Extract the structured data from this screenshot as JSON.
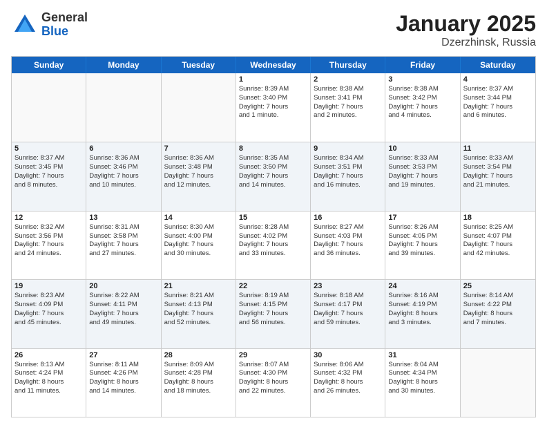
{
  "header": {
    "logo": {
      "general": "General",
      "blue": "Blue"
    },
    "title": "January 2025",
    "location": "Dzerzhinsk, Russia"
  },
  "weekdays": [
    "Sunday",
    "Monday",
    "Tuesday",
    "Wednesday",
    "Thursday",
    "Friday",
    "Saturday"
  ],
  "weeks": [
    [
      {
        "day": "",
        "empty": true,
        "info": ""
      },
      {
        "day": "",
        "empty": true,
        "info": ""
      },
      {
        "day": "",
        "empty": true,
        "info": ""
      },
      {
        "day": "1",
        "empty": false,
        "info": "Sunrise: 8:39 AM\nSunset: 3:40 PM\nDaylight: 7 hours\nand 1 minute."
      },
      {
        "day": "2",
        "empty": false,
        "info": "Sunrise: 8:38 AM\nSunset: 3:41 PM\nDaylight: 7 hours\nand 2 minutes."
      },
      {
        "day": "3",
        "empty": false,
        "info": "Sunrise: 8:38 AM\nSunset: 3:42 PM\nDaylight: 7 hours\nand 4 minutes."
      },
      {
        "day": "4",
        "empty": false,
        "info": "Sunrise: 8:37 AM\nSunset: 3:44 PM\nDaylight: 7 hours\nand 6 minutes."
      }
    ],
    [
      {
        "day": "5",
        "empty": false,
        "info": "Sunrise: 8:37 AM\nSunset: 3:45 PM\nDaylight: 7 hours\nand 8 minutes."
      },
      {
        "day": "6",
        "empty": false,
        "info": "Sunrise: 8:36 AM\nSunset: 3:46 PM\nDaylight: 7 hours\nand 10 minutes."
      },
      {
        "day": "7",
        "empty": false,
        "info": "Sunrise: 8:36 AM\nSunset: 3:48 PM\nDaylight: 7 hours\nand 12 minutes."
      },
      {
        "day": "8",
        "empty": false,
        "info": "Sunrise: 8:35 AM\nSunset: 3:50 PM\nDaylight: 7 hours\nand 14 minutes."
      },
      {
        "day": "9",
        "empty": false,
        "info": "Sunrise: 8:34 AM\nSunset: 3:51 PM\nDaylight: 7 hours\nand 16 minutes."
      },
      {
        "day": "10",
        "empty": false,
        "info": "Sunrise: 8:33 AM\nSunset: 3:53 PM\nDaylight: 7 hours\nand 19 minutes."
      },
      {
        "day": "11",
        "empty": false,
        "info": "Sunrise: 8:33 AM\nSunset: 3:54 PM\nDaylight: 7 hours\nand 21 minutes."
      }
    ],
    [
      {
        "day": "12",
        "empty": false,
        "info": "Sunrise: 8:32 AM\nSunset: 3:56 PM\nDaylight: 7 hours\nand 24 minutes."
      },
      {
        "day": "13",
        "empty": false,
        "info": "Sunrise: 8:31 AM\nSunset: 3:58 PM\nDaylight: 7 hours\nand 27 minutes."
      },
      {
        "day": "14",
        "empty": false,
        "info": "Sunrise: 8:30 AM\nSunset: 4:00 PM\nDaylight: 7 hours\nand 30 minutes."
      },
      {
        "day": "15",
        "empty": false,
        "info": "Sunrise: 8:28 AM\nSunset: 4:02 PM\nDaylight: 7 hours\nand 33 minutes."
      },
      {
        "day": "16",
        "empty": false,
        "info": "Sunrise: 8:27 AM\nSunset: 4:03 PM\nDaylight: 7 hours\nand 36 minutes."
      },
      {
        "day": "17",
        "empty": false,
        "info": "Sunrise: 8:26 AM\nSunset: 4:05 PM\nDaylight: 7 hours\nand 39 minutes."
      },
      {
        "day": "18",
        "empty": false,
        "info": "Sunrise: 8:25 AM\nSunset: 4:07 PM\nDaylight: 7 hours\nand 42 minutes."
      }
    ],
    [
      {
        "day": "19",
        "empty": false,
        "info": "Sunrise: 8:23 AM\nSunset: 4:09 PM\nDaylight: 7 hours\nand 45 minutes."
      },
      {
        "day": "20",
        "empty": false,
        "info": "Sunrise: 8:22 AM\nSunset: 4:11 PM\nDaylight: 7 hours\nand 49 minutes."
      },
      {
        "day": "21",
        "empty": false,
        "info": "Sunrise: 8:21 AM\nSunset: 4:13 PM\nDaylight: 7 hours\nand 52 minutes."
      },
      {
        "day": "22",
        "empty": false,
        "info": "Sunrise: 8:19 AM\nSunset: 4:15 PM\nDaylight: 7 hours\nand 56 minutes."
      },
      {
        "day": "23",
        "empty": false,
        "info": "Sunrise: 8:18 AM\nSunset: 4:17 PM\nDaylight: 7 hours\nand 59 minutes."
      },
      {
        "day": "24",
        "empty": false,
        "info": "Sunrise: 8:16 AM\nSunset: 4:19 PM\nDaylight: 8 hours\nand 3 minutes."
      },
      {
        "day": "25",
        "empty": false,
        "info": "Sunrise: 8:14 AM\nSunset: 4:22 PM\nDaylight: 8 hours\nand 7 minutes."
      }
    ],
    [
      {
        "day": "26",
        "empty": false,
        "info": "Sunrise: 8:13 AM\nSunset: 4:24 PM\nDaylight: 8 hours\nand 11 minutes."
      },
      {
        "day": "27",
        "empty": false,
        "info": "Sunrise: 8:11 AM\nSunset: 4:26 PM\nDaylight: 8 hours\nand 14 minutes."
      },
      {
        "day": "28",
        "empty": false,
        "info": "Sunrise: 8:09 AM\nSunset: 4:28 PM\nDaylight: 8 hours\nand 18 minutes."
      },
      {
        "day": "29",
        "empty": false,
        "info": "Sunrise: 8:07 AM\nSunset: 4:30 PM\nDaylight: 8 hours\nand 22 minutes."
      },
      {
        "day": "30",
        "empty": false,
        "info": "Sunrise: 8:06 AM\nSunset: 4:32 PM\nDaylight: 8 hours\nand 26 minutes."
      },
      {
        "day": "31",
        "empty": false,
        "info": "Sunrise: 8:04 AM\nSunset: 4:34 PM\nDaylight: 8 hours\nand 30 minutes."
      },
      {
        "day": "",
        "empty": true,
        "info": ""
      }
    ]
  ]
}
